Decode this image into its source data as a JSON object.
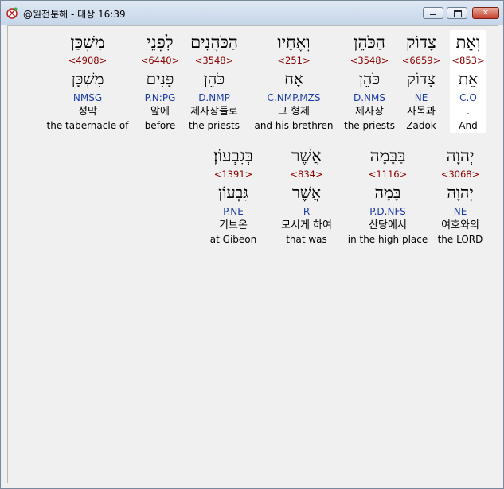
{
  "window": {
    "title": "@원전분해 - 대상 16:39",
    "minimize_glyph": "",
    "maximize_glyph": "",
    "close_glyph": "✕"
  },
  "rows": [
    {
      "words": [
        {
          "hebrew": "וְאֵת",
          "strong": "<853>",
          "lemma": "אֵת",
          "grammar": "C.O",
          "korean": ".",
          "english": "And",
          "selected": true
        },
        {
          "hebrew": "צָדוֹק",
          "strong": "<6659>",
          "lemma": "צָדוֹק",
          "grammar": "NE",
          "korean": "사독과",
          "english": "Zadok"
        },
        {
          "hebrew": "הַכֹּהֵן",
          "strong": "<3548>",
          "lemma": "כֹּהֵן",
          "grammar": "D.NMS",
          "korean": "제사장",
          "english": "the priests"
        },
        {
          "hebrew": "וְאֶחָיו",
          "strong": "<251>",
          "lemma": "אָח",
          "grammar": "C.NMP.MZS",
          "korean": "그 형제",
          "english": "and his brethren"
        },
        {
          "hebrew": "הַכֹּהֲנִים",
          "strong": "<3548>",
          "lemma": "כֹּהֵן",
          "grammar": "D.NMP",
          "korean": "제사장들로",
          "english": "the priests"
        },
        {
          "hebrew": "לִפְנֵי",
          "strong": "<6440>",
          "lemma": "פָּנִים",
          "grammar": "P.N:PG",
          "korean": "앞에",
          "english": "before"
        },
        {
          "hebrew": "מִשְׁכַּן",
          "strong": "<4908>",
          "lemma": "מִשְׁכָּן",
          "grammar": "NMSG",
          "korean": "성막",
          "english": "the tabernacle of"
        }
      ]
    },
    {
      "words": [
        {
          "hebrew": "יְהוָה",
          "strong": "<3068>",
          "lemma": "יְהוָה",
          "grammar": "NE",
          "korean": "여호와의",
          "english": "the LORD"
        },
        {
          "hebrew": "בַּבָּמָה",
          "strong": "<1116>",
          "lemma": "בָּמָה",
          "grammar": "P.D.NFS",
          "korean": "산당에서",
          "english": "in the high place"
        },
        {
          "hebrew": "אֲשֶׁר",
          "strong": "<834>",
          "lemma": "אֲשֶׁר",
          "grammar": "R",
          "korean": "모시게 하여",
          "english": "that was"
        },
        {
          "hebrew": "בְּגִבְעוֹן׃",
          "strong": "<1391>",
          "lemma": "גִּבְעוֹן",
          "grammar": "P.NE",
          "korean": "기브온",
          "english": "at Gibeon"
        }
      ]
    }
  ]
}
